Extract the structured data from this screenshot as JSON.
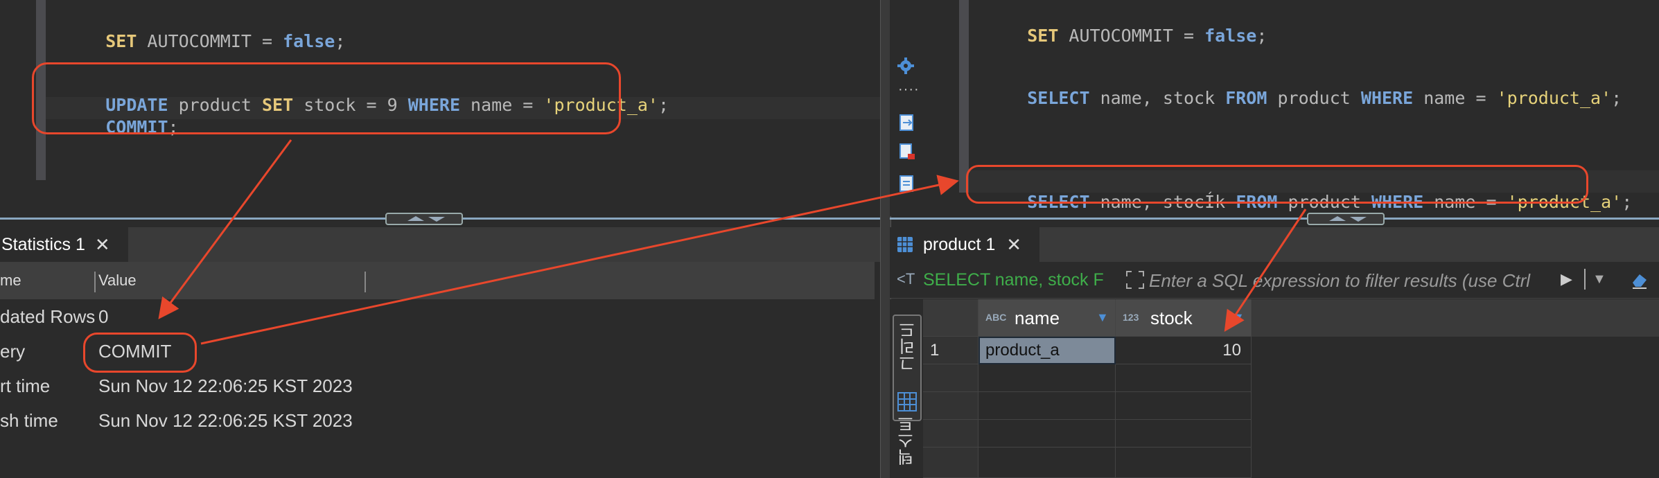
{
  "left_editor": {
    "line1": {
      "kw": "SET",
      "rest": " AUTOCOMMIT = ",
      "bool": "false",
      "end": ";"
    },
    "line2": {
      "kw1": "UPDATE",
      "t1": " product ",
      "kw2": "SET",
      "t2": " stock = 9 ",
      "kw3": "WHERE",
      "t3": " name = ",
      "str": "'product_a'",
      "end": ";"
    },
    "line3": {
      "kw": "COMMIT",
      "end": ";"
    }
  },
  "right_editor": {
    "line1": {
      "kw": "SET",
      "rest": " AUTOCOMMIT = ",
      "bool": "false",
      "end": ";"
    },
    "line2": {
      "kw1": "SELECT",
      "t1": " name, stock ",
      "kw2": "FROM",
      "t2": " product ",
      "kw3": "WHERE",
      "t3": " name = ",
      "str": "'product_a'",
      "end": ";"
    },
    "line3": {
      "kw1": "SELECT",
      "t1": " name, stocÍk ",
      "kw2": "FROM",
      "t2": " product ",
      "kw3": "WHERE",
      "t3": " name = ",
      "str": "'product_a'",
      "end": ";"
    }
  },
  "stats_panel": {
    "tab_label": "Statistics 1",
    "col_name": "me",
    "col_value": "Value",
    "rows": [
      {
        "name": "dated Rows",
        "value": "0"
      },
      {
        "name": "ery",
        "value": "COMMIT"
      },
      {
        "name": "rt time",
        "value": "Sun Nov 12 22:06:25 KST 2023"
      },
      {
        "name": "sh time",
        "value": "Sun Nov 12 22:06:25 KST 2023"
      }
    ]
  },
  "results_panel": {
    "tab_label": "product 1",
    "filter_sql": "SELECT name, stock F",
    "filter_placeholder": "Enter a SQL expression to filter results (use Ctrl",
    "side_tab_grid": "그리드",
    "side_tab_text": "텍스트",
    "columns": [
      {
        "type": "ABC",
        "name": "name"
      },
      {
        "type": "123",
        "name": "stock"
      }
    ],
    "rows": [
      {
        "num": "1",
        "name": "product_a",
        "stock": "10"
      }
    ]
  },
  "colors": {
    "accent_red": "#e8472c",
    "keyword_blue": "#7aa6da",
    "keyword_yellow": "#e6c87a",
    "string": "#e6d27a"
  }
}
